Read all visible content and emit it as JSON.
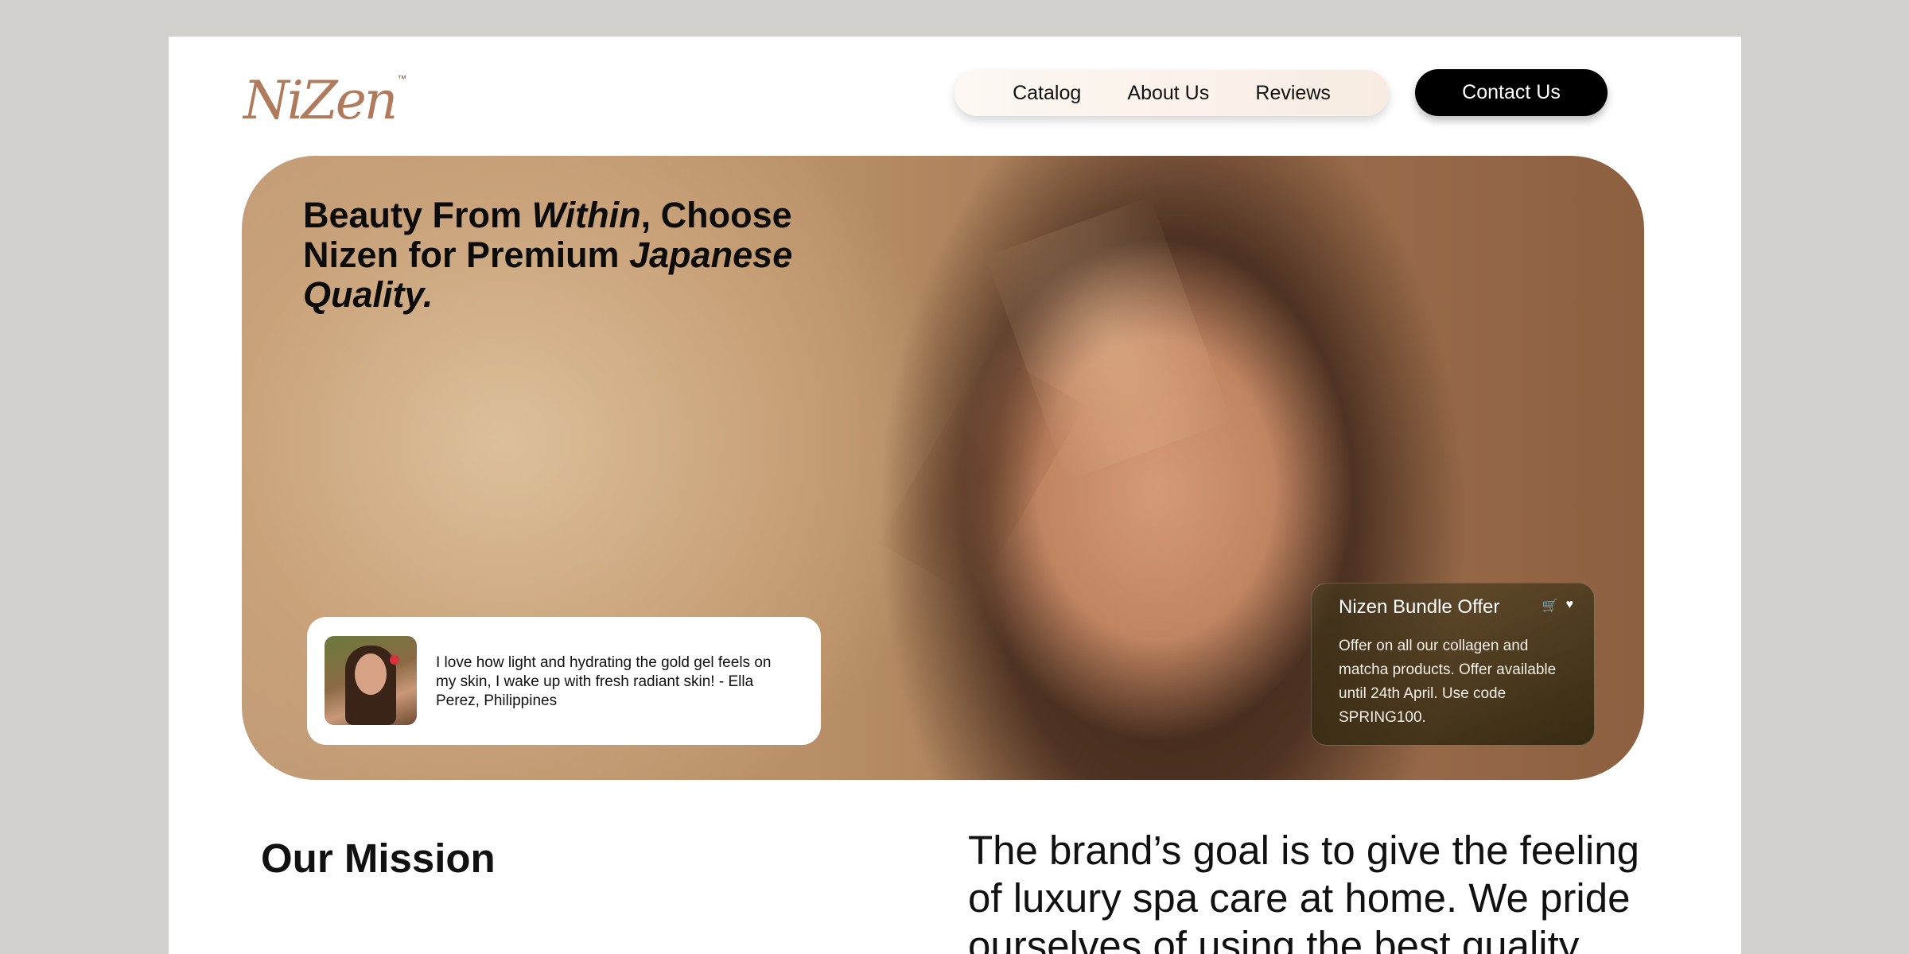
{
  "brand": {
    "logo_text": "NiZen",
    "trademark": "™",
    "accent_color": "#b07a5c"
  },
  "nav": {
    "items": [
      {
        "label": "Catalog"
      },
      {
        "label": "About Us"
      },
      {
        "label": "Reviews"
      }
    ],
    "contact_label": "Contact Us"
  },
  "hero": {
    "headline": {
      "part1": "Beauty From ",
      "emphasis1": "Within",
      "part2": ", Choose Nizen for Premium ",
      "emphasis2": "Japanese Quality."
    },
    "testimonial": {
      "quote": "I love how light and hydrating the gold gel feels on my skin, I wake up with fresh radiant skin!  - Ella Perez, Philippines"
    },
    "offer": {
      "title": "Nizen Bundle Offer",
      "text": "Offer on all our collagen and matcha products. Offer available until 24th April. Use code SPRING100.",
      "icons": [
        "cart-icon",
        "heart-icon"
      ]
    }
  },
  "mission": {
    "label": "Our Mission",
    "text": "The brand’s goal is to give the feeling of luxury spa care at home. We pride ourselves of using the best quality"
  }
}
